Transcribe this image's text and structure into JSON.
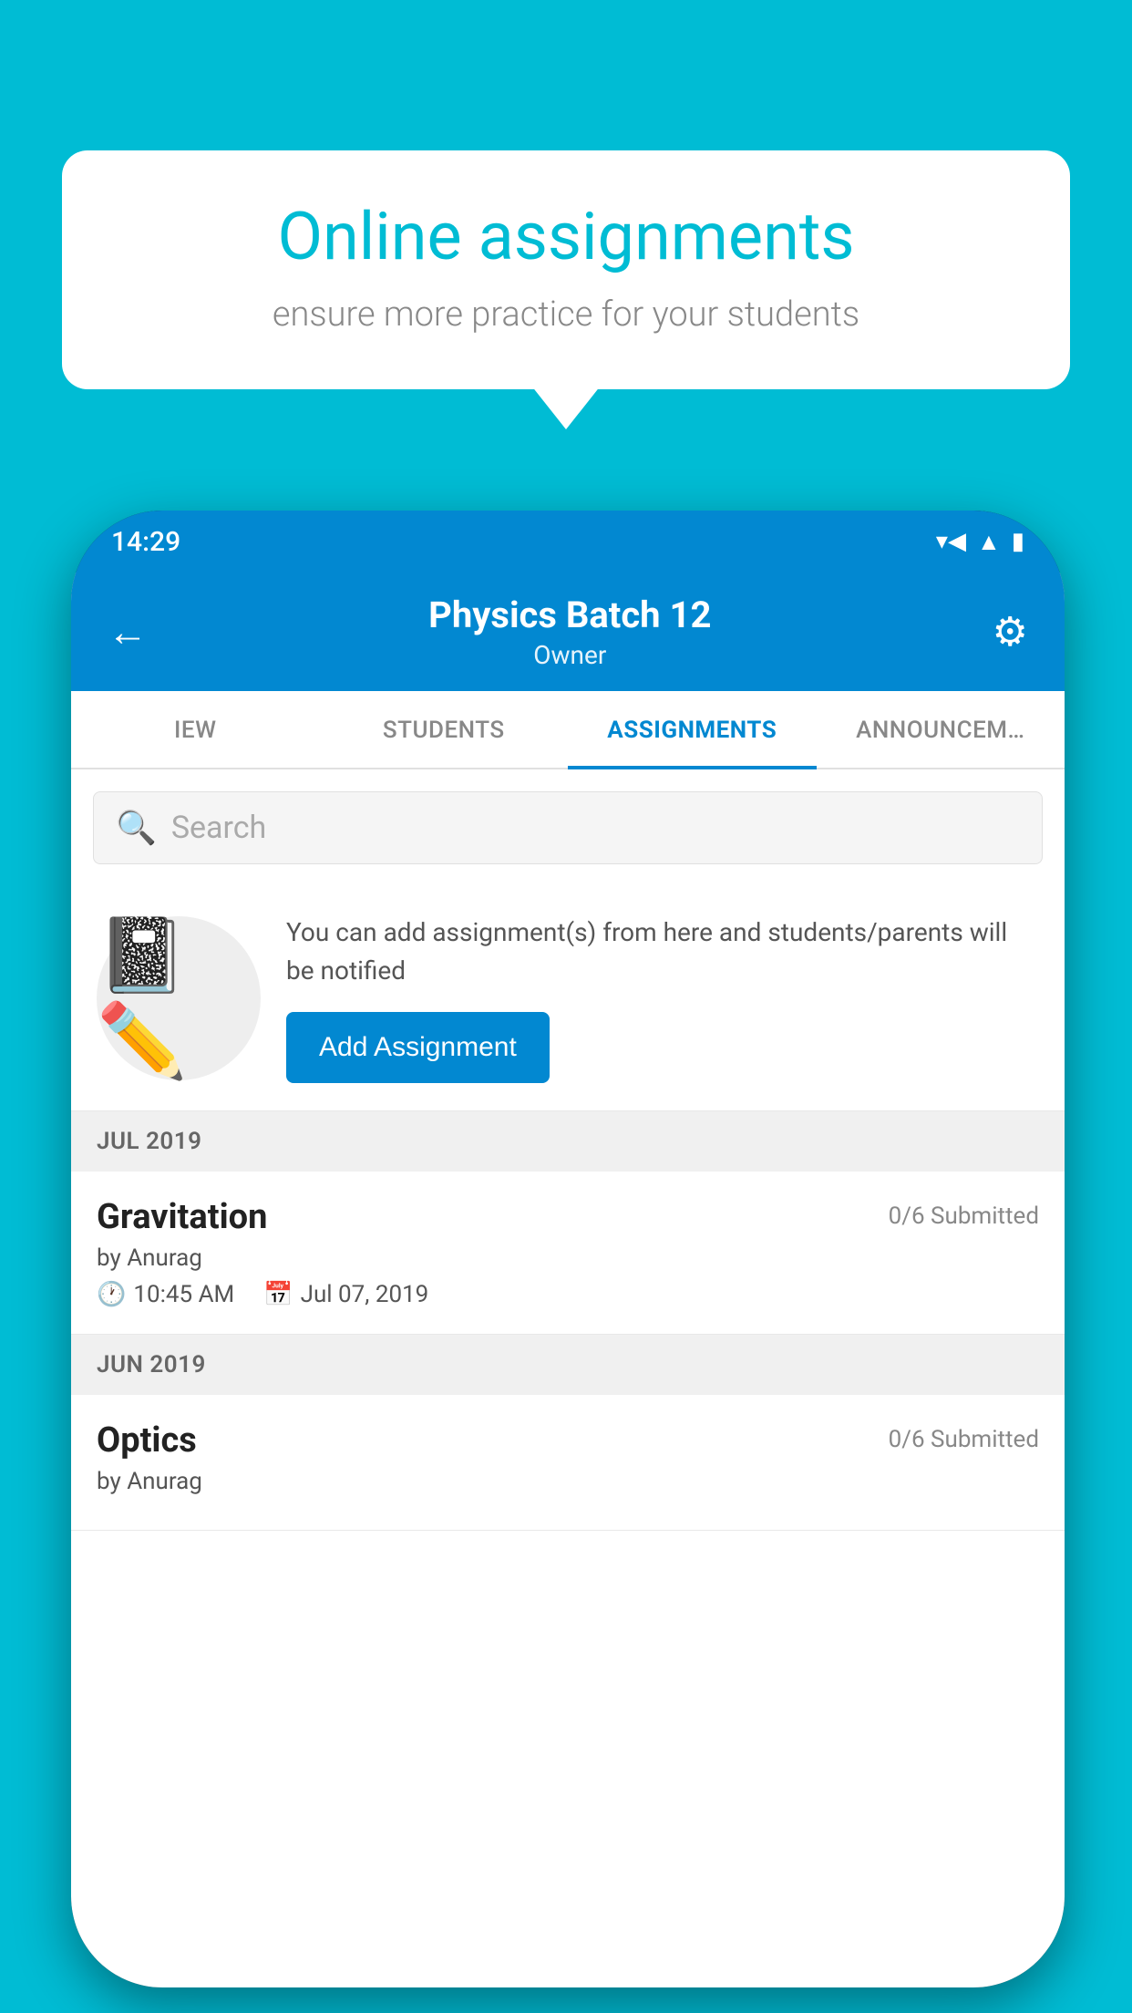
{
  "background_color": "#00bcd4",
  "speech_bubble": {
    "title": "Online assignments",
    "subtitle": "ensure more practice for your students"
  },
  "status_bar": {
    "time": "14:29",
    "wifi_icon": "wifi",
    "signal_icon": "signal",
    "battery_icon": "battery"
  },
  "app_header": {
    "title": "Physics Batch 12",
    "subtitle": "Owner",
    "back_icon": "←",
    "settings_icon": "⚙"
  },
  "tabs": [
    {
      "label": "IEW",
      "active": false
    },
    {
      "label": "STUDENTS",
      "active": false
    },
    {
      "label": "ASSIGNMENTS",
      "active": true
    },
    {
      "label": "ANNOUNCEM…",
      "active": false
    }
  ],
  "search": {
    "placeholder": "Search"
  },
  "assignment_promo": {
    "description": "You can add assignment(s) from here and students/parents will be notified",
    "button_label": "Add Assignment"
  },
  "sections": [
    {
      "label": "JUL 2019",
      "assignments": [
        {
          "name": "Gravitation",
          "submitted": "0/6 Submitted",
          "author": "by Anurag",
          "time": "10:45 AM",
          "date": "Jul 07, 2019"
        }
      ]
    },
    {
      "label": "JUN 2019",
      "assignments": [
        {
          "name": "Optics",
          "submitted": "0/6 Submitted",
          "author": "by Anurag",
          "time": "",
          "date": ""
        }
      ]
    }
  ]
}
